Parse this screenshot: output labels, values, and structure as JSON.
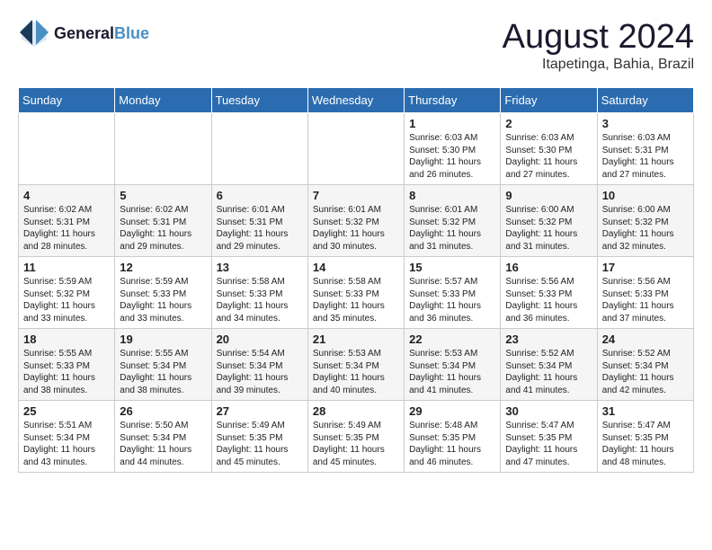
{
  "header": {
    "logo_line1": "General",
    "logo_line2": "Blue",
    "month": "August 2024",
    "location": "Itapetinga, Bahia, Brazil"
  },
  "days_of_week": [
    "Sunday",
    "Monday",
    "Tuesday",
    "Wednesday",
    "Thursday",
    "Friday",
    "Saturday"
  ],
  "weeks": [
    [
      {
        "day": "",
        "info": ""
      },
      {
        "day": "",
        "info": ""
      },
      {
        "day": "",
        "info": ""
      },
      {
        "day": "",
        "info": ""
      },
      {
        "day": "1",
        "info": "Sunrise: 6:03 AM\nSunset: 5:30 PM\nDaylight: 11 hours and 26 minutes."
      },
      {
        "day": "2",
        "info": "Sunrise: 6:03 AM\nSunset: 5:30 PM\nDaylight: 11 hours and 27 minutes."
      },
      {
        "day": "3",
        "info": "Sunrise: 6:03 AM\nSunset: 5:31 PM\nDaylight: 11 hours and 27 minutes."
      }
    ],
    [
      {
        "day": "4",
        "info": "Sunrise: 6:02 AM\nSunset: 5:31 PM\nDaylight: 11 hours and 28 minutes."
      },
      {
        "day": "5",
        "info": "Sunrise: 6:02 AM\nSunset: 5:31 PM\nDaylight: 11 hours and 29 minutes."
      },
      {
        "day": "6",
        "info": "Sunrise: 6:01 AM\nSunset: 5:31 PM\nDaylight: 11 hours and 29 minutes."
      },
      {
        "day": "7",
        "info": "Sunrise: 6:01 AM\nSunset: 5:32 PM\nDaylight: 11 hours and 30 minutes."
      },
      {
        "day": "8",
        "info": "Sunrise: 6:01 AM\nSunset: 5:32 PM\nDaylight: 11 hours and 31 minutes."
      },
      {
        "day": "9",
        "info": "Sunrise: 6:00 AM\nSunset: 5:32 PM\nDaylight: 11 hours and 31 minutes."
      },
      {
        "day": "10",
        "info": "Sunrise: 6:00 AM\nSunset: 5:32 PM\nDaylight: 11 hours and 32 minutes."
      }
    ],
    [
      {
        "day": "11",
        "info": "Sunrise: 5:59 AM\nSunset: 5:32 PM\nDaylight: 11 hours and 33 minutes."
      },
      {
        "day": "12",
        "info": "Sunrise: 5:59 AM\nSunset: 5:33 PM\nDaylight: 11 hours and 33 minutes."
      },
      {
        "day": "13",
        "info": "Sunrise: 5:58 AM\nSunset: 5:33 PM\nDaylight: 11 hours and 34 minutes."
      },
      {
        "day": "14",
        "info": "Sunrise: 5:58 AM\nSunset: 5:33 PM\nDaylight: 11 hours and 35 minutes."
      },
      {
        "day": "15",
        "info": "Sunrise: 5:57 AM\nSunset: 5:33 PM\nDaylight: 11 hours and 36 minutes."
      },
      {
        "day": "16",
        "info": "Sunrise: 5:56 AM\nSunset: 5:33 PM\nDaylight: 11 hours and 36 minutes."
      },
      {
        "day": "17",
        "info": "Sunrise: 5:56 AM\nSunset: 5:33 PM\nDaylight: 11 hours and 37 minutes."
      }
    ],
    [
      {
        "day": "18",
        "info": "Sunrise: 5:55 AM\nSunset: 5:33 PM\nDaylight: 11 hours and 38 minutes."
      },
      {
        "day": "19",
        "info": "Sunrise: 5:55 AM\nSunset: 5:34 PM\nDaylight: 11 hours and 38 minutes."
      },
      {
        "day": "20",
        "info": "Sunrise: 5:54 AM\nSunset: 5:34 PM\nDaylight: 11 hours and 39 minutes."
      },
      {
        "day": "21",
        "info": "Sunrise: 5:53 AM\nSunset: 5:34 PM\nDaylight: 11 hours and 40 minutes."
      },
      {
        "day": "22",
        "info": "Sunrise: 5:53 AM\nSunset: 5:34 PM\nDaylight: 11 hours and 41 minutes."
      },
      {
        "day": "23",
        "info": "Sunrise: 5:52 AM\nSunset: 5:34 PM\nDaylight: 11 hours and 41 minutes."
      },
      {
        "day": "24",
        "info": "Sunrise: 5:52 AM\nSunset: 5:34 PM\nDaylight: 11 hours and 42 minutes."
      }
    ],
    [
      {
        "day": "25",
        "info": "Sunrise: 5:51 AM\nSunset: 5:34 PM\nDaylight: 11 hours and 43 minutes."
      },
      {
        "day": "26",
        "info": "Sunrise: 5:50 AM\nSunset: 5:34 PM\nDaylight: 11 hours and 44 minutes."
      },
      {
        "day": "27",
        "info": "Sunrise: 5:49 AM\nSunset: 5:35 PM\nDaylight: 11 hours and 45 minutes."
      },
      {
        "day": "28",
        "info": "Sunrise: 5:49 AM\nSunset: 5:35 PM\nDaylight: 11 hours and 45 minutes."
      },
      {
        "day": "29",
        "info": "Sunrise: 5:48 AM\nSunset: 5:35 PM\nDaylight: 11 hours and 46 minutes."
      },
      {
        "day": "30",
        "info": "Sunrise: 5:47 AM\nSunset: 5:35 PM\nDaylight: 11 hours and 47 minutes."
      },
      {
        "day": "31",
        "info": "Sunrise: 5:47 AM\nSunset: 5:35 PM\nDaylight: 11 hours and 48 minutes."
      }
    ]
  ]
}
